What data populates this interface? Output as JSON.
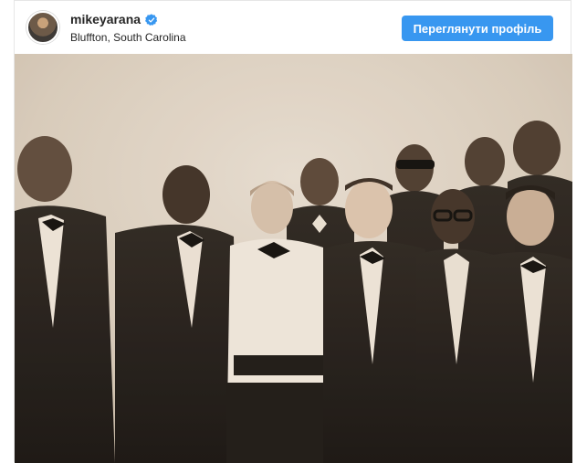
{
  "post": {
    "username": "mikeyarana",
    "location": "Bluffton, South Carolina",
    "verified_label": "verified",
    "view_profile_label": "Переглянути профіль"
  },
  "icons": {
    "verified": "verified-badge-icon"
  },
  "colors": {
    "button_blue": "#3897f0",
    "verified_blue": "#3897f0",
    "photo_tone": "#ddd2c4"
  }
}
